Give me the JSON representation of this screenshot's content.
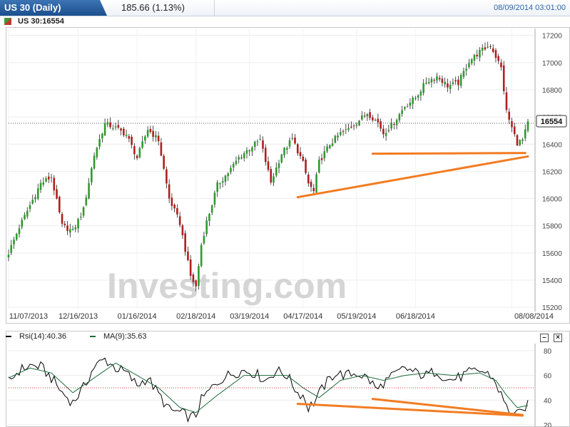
{
  "header": {
    "title": "US 30 (Daily)",
    "change": "185.66 (1.13%)",
    "datetime": "08/09/2014 03:01:00"
  },
  "symbol_label": "US 30:16554",
  "price_badge": "16554",
  "watermark": "Investing.com",
  "rsi_legend": {
    "rsi": "Rsi(14):40.36",
    "ma": "MA(9):35.63"
  },
  "controls": {
    "close": "×",
    "minimize": "–"
  },
  "chart_data": [
    {
      "type": "candlestick",
      "title": "US 30 (Daily)",
      "y_ticks": [
        15200,
        15400,
        15600,
        15800,
        16000,
        16200,
        16400,
        16600,
        16800,
        17000,
        17200
      ],
      "ylim": [
        15190,
        17230
      ],
      "x_tick_labels": [
        "11/07/2013",
        "12/16/2013",
        "01/16/2014",
        "02/18/2014",
        "03/19/2014",
        "04/17/2014",
        "05/19/2014",
        "06/18/2014",
        "08/08/2014"
      ],
      "x_tick_index": [
        0,
        26,
        48,
        70,
        90,
        110,
        130,
        152,
        188
      ],
      "last_price": 16554,
      "anchors": [
        [
          0,
          15600
        ],
        [
          4,
          15790
        ],
        [
          8,
          15950
        ],
        [
          12,
          16110
        ],
        [
          16,
          16160
        ],
        [
          20,
          15800
        ],
        [
          24,
          15760
        ],
        [
          28,
          15920
        ],
        [
          32,
          16320
        ],
        [
          36,
          16550
        ],
        [
          40,
          16520
        ],
        [
          44,
          16470
        ],
        [
          48,
          16300
        ],
        [
          52,
          16510
        ],
        [
          56,
          16430
        ],
        [
          60,
          16000
        ],
        [
          64,
          15820
        ],
        [
          68,
          15430
        ],
        [
          70,
          15350
        ],
        [
          72,
          15660
        ],
        [
          74,
          15830
        ],
        [
          76,
          15960
        ],
        [
          78,
          16100
        ],
        [
          82,
          16190
        ],
        [
          86,
          16300
        ],
        [
          90,
          16370
        ],
        [
          94,
          16430
        ],
        [
          98,
          16120
        ],
        [
          102,
          16330
        ],
        [
          106,
          16440
        ],
        [
          110,
          16260
        ],
        [
          112,
          16110
        ],
        [
          114,
          16050
        ],
        [
          116,
          16270
        ],
        [
          120,
          16400
        ],
        [
          124,
          16480
        ],
        [
          126,
          16500
        ],
        [
          130,
          16560
        ],
        [
          134,
          16630
        ],
        [
          138,
          16560
        ],
        [
          140,
          16480
        ],
        [
          144,
          16560
        ],
        [
          148,
          16680
        ],
        [
          152,
          16740
        ],
        [
          156,
          16860
        ],
        [
          160,
          16900
        ],
        [
          164,
          16830
        ],
        [
          168,
          16850
        ],
        [
          172,
          17010
        ],
        [
          176,
          17080
        ],
        [
          180,
          17130
        ],
        [
          184,
          16960
        ],
        [
          186,
          16640
        ],
        [
          188,
          16520
        ],
        [
          190,
          16410
        ],
        [
          192,
          16430
        ],
        [
          194,
          16554
        ]
      ],
      "trendlines": [
        {
          "from": [
            108,
            16010
          ],
          "to": [
            194,
            16310
          ]
        },
        {
          "from": [
            136,
            16330
          ],
          "to": [
            193,
            16335
          ]
        }
      ]
    },
    {
      "type": "line",
      "title": "Rsi(14)",
      "y_ticks": [
        20,
        40,
        60,
        80
      ],
      "ylim": [
        20,
        84
      ],
      "reference_level": 50,
      "series": [
        {
          "name": "Rsi(14)",
          "color": "#000000",
          "last": 40.36,
          "anchors": [
            [
              0,
              55
            ],
            [
              4,
              64
            ],
            [
              8,
              68
            ],
            [
              12,
              67
            ],
            [
              16,
              58
            ],
            [
              20,
              46
            ],
            [
              24,
              38
            ],
            [
              28,
              50
            ],
            [
              32,
              67
            ],
            [
              36,
              73
            ],
            [
              40,
              66
            ],
            [
              44,
              62
            ],
            [
              48,
              52
            ],
            [
              52,
              58
            ],
            [
              56,
              45
            ],
            [
              60,
              32
            ],
            [
              64,
              30
            ],
            [
              68,
              26
            ],
            [
              70,
              28
            ],
            [
              72,
              40
            ],
            [
              76,
              50
            ],
            [
              80,
              58
            ],
            [
              84,
              62
            ],
            [
              88,
              64
            ],
            [
              92,
              62
            ],
            [
              96,
              56
            ],
            [
              100,
              64
            ],
            [
              104,
              60
            ],
            [
              108,
              46
            ],
            [
              110,
              44
            ],
            [
              112,
              34
            ],
            [
              114,
              38
            ],
            [
              118,
              52
            ],
            [
              122,
              62
            ],
            [
              126,
              60
            ],
            [
              130,
              62
            ],
            [
              134,
              58
            ],
            [
              138,
              48
            ],
            [
              140,
              54
            ],
            [
              144,
              60
            ],
            [
              148,
              66
            ],
            [
              152,
              62
            ],
            [
              156,
              60
            ],
            [
              160,
              64
            ],
            [
              164,
              56
            ],
            [
              168,
              58
            ],
            [
              172,
              62
            ],
            [
              176,
              64
            ],
            [
              180,
              60
            ],
            [
              182,
              54
            ],
            [
              184,
              44
            ],
            [
              186,
              34
            ],
            [
              188,
              30
            ],
            [
              190,
              28
            ],
            [
              192,
              30
            ],
            [
              194,
              40
            ]
          ]
        },
        {
          "name": "MA(9)",
          "color": "#1e6b3c",
          "last": 35.63,
          "anchors": [
            [
              0,
              58
            ],
            [
              8,
              66
            ],
            [
              16,
              62
            ],
            [
              24,
              46
            ],
            [
              32,
              58
            ],
            [
              40,
              70
            ],
            [
              48,
              60
            ],
            [
              56,
              50
            ],
            [
              64,
              34
            ],
            [
              70,
              30
            ],
            [
              78,
              44
            ],
            [
              88,
              60
            ],
            [
              96,
              60
            ],
            [
              104,
              60
            ],
            [
              110,
              50
            ],
            [
              116,
              42
            ],
            [
              124,
              56
            ],
            [
              132,
              60
            ],
            [
              140,
              56
            ],
            [
              148,
              60
            ],
            [
              156,
              62
            ],
            [
              166,
              60
            ],
            [
              176,
              62
            ],
            [
              182,
              56
            ],
            [
              186,
              44
            ],
            [
              190,
              34
            ],
            [
              194,
              35.63
            ]
          ]
        }
      ],
      "trendlines": [
        {
          "from": [
            108,
            37
          ],
          "to": [
            192,
            27.5
          ]
        },
        {
          "from": [
            136,
            41
          ],
          "to": [
            192,
            28
          ]
        }
      ]
    }
  ]
}
